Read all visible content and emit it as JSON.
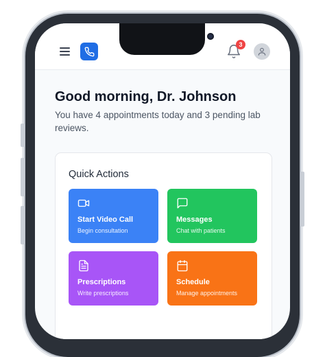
{
  "header": {
    "notification_count": "3"
  },
  "greeting": {
    "title": "Good morning, Dr. Johnson",
    "subtitle": "You have 4 appointments today and 3 pending lab reviews."
  },
  "quick_actions": {
    "title": "Quick Actions",
    "items": [
      {
        "label": "Start Video Call",
        "description": "Begin consultation",
        "icon": "video-icon",
        "color": "#3b82f6"
      },
      {
        "label": "Messages",
        "description": "Chat with patients",
        "icon": "message-icon",
        "color": "#22c55e"
      },
      {
        "label": "Prescriptions",
        "description": "Write prescriptions",
        "icon": "document-icon",
        "color": "#a855f7"
      },
      {
        "label": "Schedule",
        "description": "Manage appointments",
        "icon": "calendar-icon",
        "color": "#f97316"
      }
    ]
  },
  "colors": {
    "brand": "#1f6de4",
    "badge": "#ef4444"
  }
}
